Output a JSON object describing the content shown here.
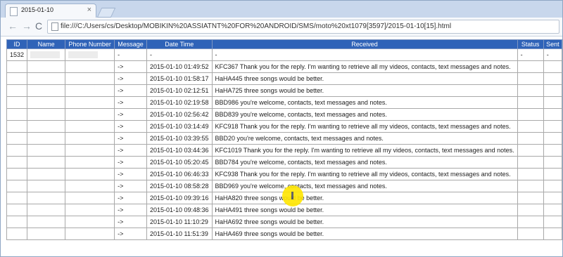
{
  "tab": {
    "title": "2015-01-10",
    "close": "×"
  },
  "toolbar": {
    "back": "←",
    "forward": "→",
    "reload": "C",
    "url": "file:///C:/Users/cs/Desktop/MOBIKIN%20ASSIATNT%20FOR%20ANDROID/SMS/moto%20xt1079[3597]/2015-01-10[15].html"
  },
  "table": {
    "headers": [
      "ID",
      "Name",
      "Phone Number",
      "Message",
      "Date Time",
      "Received",
      "Status",
      "Sent"
    ],
    "first_row": {
      "id": "1532",
      "message": "-",
      "datetime": "-",
      "received": "-",
      "status": "-",
      "sent": "-"
    },
    "rows": [
      {
        "message": "->",
        "datetime": "2015-01-10 01:49:52",
        "received": "KFC367 Thank you for the reply. I'm wanting to retrieve all my videos, contacts, text messages and notes."
      },
      {
        "message": "->",
        "datetime": "2015-01-10 01:58:17",
        "received": "HaHA445 three songs would be better."
      },
      {
        "message": "->",
        "datetime": "2015-01-10 02:12:51",
        "received": "HaHA725 three songs would be better."
      },
      {
        "message": "->",
        "datetime": "2015-01-10 02:19:58",
        "received": "BBD986 you're welcome, contacts, text messages and notes."
      },
      {
        "message": "->",
        "datetime": "2015-01-10 02:56:42",
        "received": "BBD839 you're welcome, contacts, text messages and notes."
      },
      {
        "message": "->",
        "datetime": "2015-01-10 03:14:49",
        "received": "KFC918 Thank you for the reply. I'm wanting to retrieve all my videos, contacts, text messages and notes."
      },
      {
        "message": "->",
        "datetime": "2015-01-10 03:39:55",
        "received": "BBD20 you're welcome, contacts, text messages and notes."
      },
      {
        "message": "->",
        "datetime": "2015-01-10 03:44:36",
        "received": "KFC1019 Thank you for the reply. I'm wanting to retrieve all my videos, contacts, text messages and notes."
      },
      {
        "message": "->",
        "datetime": "2015-01-10 05:20:45",
        "received": "BBD784 you're welcome, contacts, text messages and notes."
      },
      {
        "message": "->",
        "datetime": "2015-01-10 06:46:33",
        "received": "KFC938 Thank you for the reply. I'm wanting to retrieve all my videos, contacts, text messages and notes."
      },
      {
        "message": "->",
        "datetime": "2015-01-10 08:58:28",
        "received": "BBD969 you're welcome, contacts, text messages and notes."
      },
      {
        "message": "->",
        "datetime": "2015-01-10 09:39:16",
        "received": "HaHA820 three songs would be better."
      },
      {
        "message": "->",
        "datetime": "2015-01-10 09:48:36",
        "received": "HaHA491 three songs would be better."
      },
      {
        "message": "->",
        "datetime": "2015-01-10 11:10:29",
        "received": "HaHA692 three songs would be better."
      },
      {
        "message": "->",
        "datetime": "2015-01-10 11:51:39",
        "received": "HaHA469 three songs would be better."
      }
    ]
  },
  "colors": {
    "header_bg": "#2f63b8",
    "highlight": "#ffe600"
  }
}
